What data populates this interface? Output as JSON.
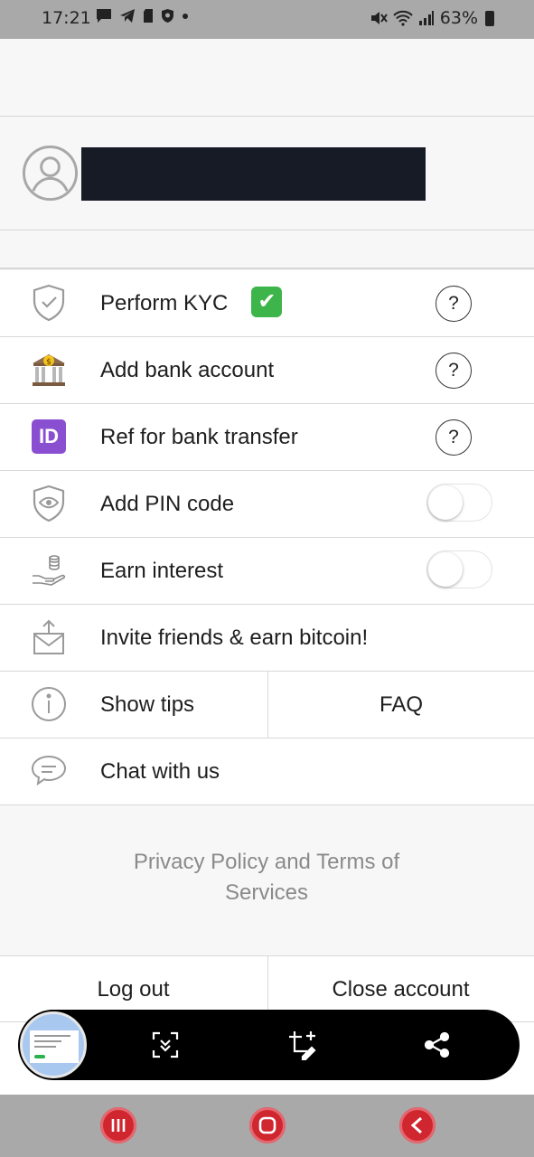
{
  "status_bar": {
    "time": "17:21",
    "battery": "63%",
    "icons": [
      "message-icon",
      "telegram-icon",
      "sd-card-icon",
      "shield-icon",
      "dot-icon",
      "mute-icon",
      "wifi-icon",
      "signal-icon",
      "battery-icon"
    ]
  },
  "menu": {
    "kyc_label": "Perform KYC",
    "bank_label": "Add bank account",
    "ref_label": "Ref for bank transfer",
    "pin_label": "Add PIN code",
    "interest_label": "Earn interest",
    "invite_label": "Invite friends & earn bitcoin!",
    "tips_label": "Show tips",
    "faq_label": "FAQ",
    "chat_label": "Chat with us",
    "help_glyph": "?",
    "pin_enabled": false,
    "interest_enabled": false
  },
  "icons": {
    "id_badge": "ID",
    "check": "✔"
  },
  "footer": {
    "privacy": "Privacy Policy and Terms of Services",
    "logout": "Log out",
    "close_account": "Close account"
  },
  "colors": {
    "kyc_check": "#3db54a",
    "id_badge": "#8a4fd0",
    "nav_buttons": "#d0262f"
  }
}
